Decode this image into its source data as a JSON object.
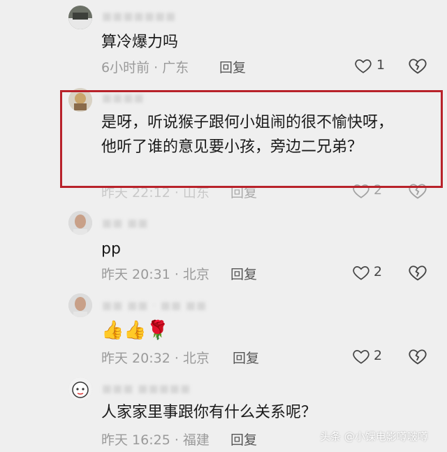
{
  "comments": [
    {
      "content": "算冷爆力吗",
      "meta": "6小时前 · 广东",
      "reply_label": "回复",
      "likes": "1"
    },
    {
      "content": "是呀，听说猴子跟何小姐闹的很不愉快呀，他听了谁的意见要小孩，旁边二兄弟？",
      "meta": "昨天 22:12 · 山东",
      "reply_label": "回复",
      "likes": "2"
    },
    {
      "content": "pp",
      "meta": "昨天 20:31 · 北京",
      "reply_label": "回复",
      "likes": "2"
    },
    {
      "content": "👍👍🌹",
      "meta": "昨天 20:32 · 北京",
      "reply_label": "回复",
      "likes": "2"
    },
    {
      "content": "人家家里事跟你有什么关系呢？",
      "meta": "昨天 16:25 · 福建",
      "reply_label": "回复",
      "likes": ""
    }
  ],
  "watermark": "头条 @小馃电影噂啵噂",
  "colors": {
    "highlight_border": "#b8222a",
    "background": "#efefef"
  },
  "icons": [
    "heart-outline-icon",
    "broken-heart-icon"
  ]
}
